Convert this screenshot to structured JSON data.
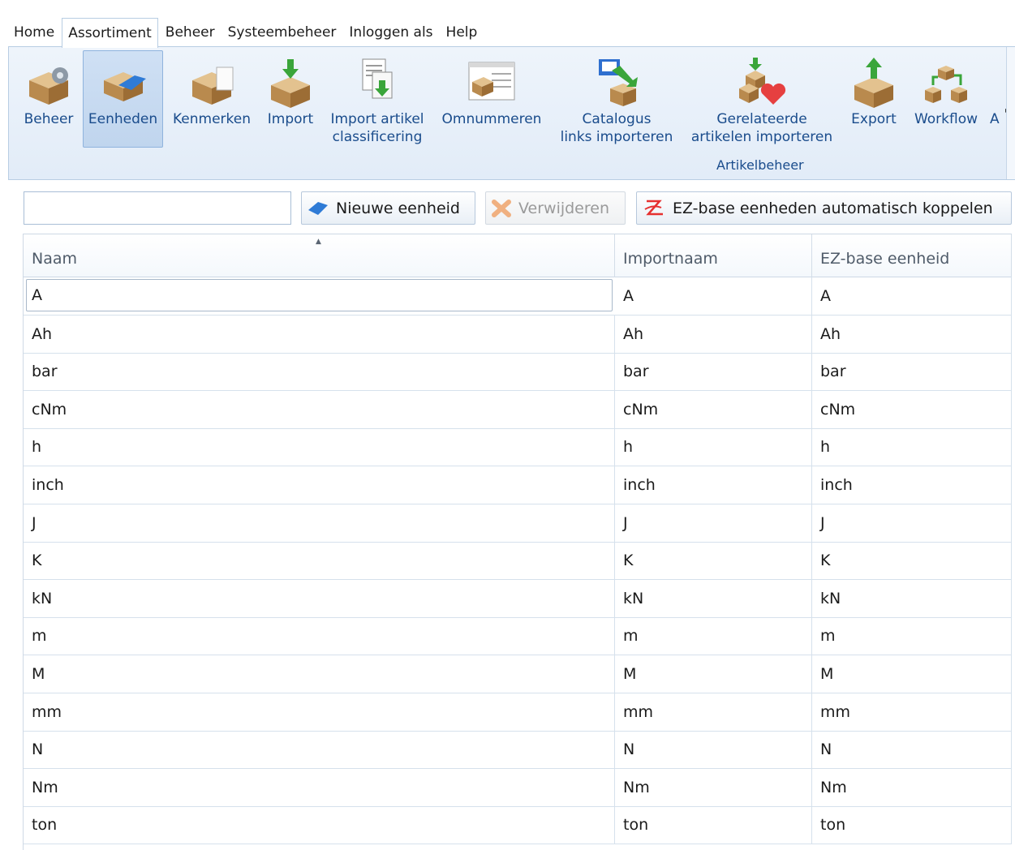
{
  "menu": {
    "tabs": [
      {
        "label": "Home"
      },
      {
        "label": "Assortiment",
        "active": true
      },
      {
        "label": "Beheer"
      },
      {
        "label": "Systeembeheer"
      },
      {
        "label": "Inloggen als"
      },
      {
        "label": "Help"
      }
    ]
  },
  "ribbon": {
    "buttons": {
      "beheer": "Beheer",
      "eenheden": "Eenheden",
      "kenmerken": "Kenmerken",
      "import": "Import",
      "import_classificering": "Import artikel\nclassificering",
      "omnummeren": "Omnummeren",
      "catalogus": "Catalogus\nlinks importeren",
      "gerelateerde": "Gerelateerde\nartikelen importeren",
      "export": "Export",
      "workflow": "Workflow",
      "overflow": "A"
    },
    "group_label": "Artikelbeheer",
    "icons": {
      "beheer": "box-gear-icon",
      "eenheden": "box-blue-tag-icon",
      "kenmerken": "box-document-icon",
      "import": "box-green-arrow-down-icon",
      "import_classificering": "document-green-arrow-icon",
      "omnummeren": "document-box-pencil-icon",
      "catalogus": "book-box-arrow-icon",
      "gerelateerde": "boxes-heart-icon",
      "export": "box-green-arrow-up-icon",
      "workflow": "boxes-flow-icon"
    }
  },
  "toolbar": {
    "search_value": "",
    "new_label": "Nieuwe eenheid",
    "delete_label": "Verwijderen",
    "link_label": "EZ-base eenheden automatisch koppelen"
  },
  "grid": {
    "columns": [
      "Naam",
      "Importnaam",
      "EZ-base eenheid"
    ],
    "sorted_column": "Naam",
    "sort_direction": "ascending",
    "rows": [
      [
        "A",
        "A",
        "A"
      ],
      [
        "Ah",
        "Ah",
        "Ah"
      ],
      [
        "bar",
        "bar",
        "bar"
      ],
      [
        "cNm",
        "cNm",
        "cNm"
      ],
      [
        "h",
        "h",
        "h"
      ],
      [
        "inch",
        "inch",
        "inch"
      ],
      [
        "J",
        "J",
        "J"
      ],
      [
        "K",
        "K",
        "K"
      ],
      [
        "kN",
        "kN",
        "kN"
      ],
      [
        "m",
        "m",
        "m"
      ],
      [
        "M",
        "M",
        "M"
      ],
      [
        "mm",
        "mm",
        "mm"
      ],
      [
        "N",
        "N",
        "N"
      ],
      [
        "Nm",
        "Nm",
        "Nm"
      ],
      [
        "ton",
        "ton",
        "ton"
      ]
    ]
  },
  "colors": {
    "ribbon_text": "#1a4c8c",
    "ribbon_bg": "#e2ecf8",
    "selected_button": "#c0d5ee",
    "grid_line": "#d6e1ec"
  }
}
